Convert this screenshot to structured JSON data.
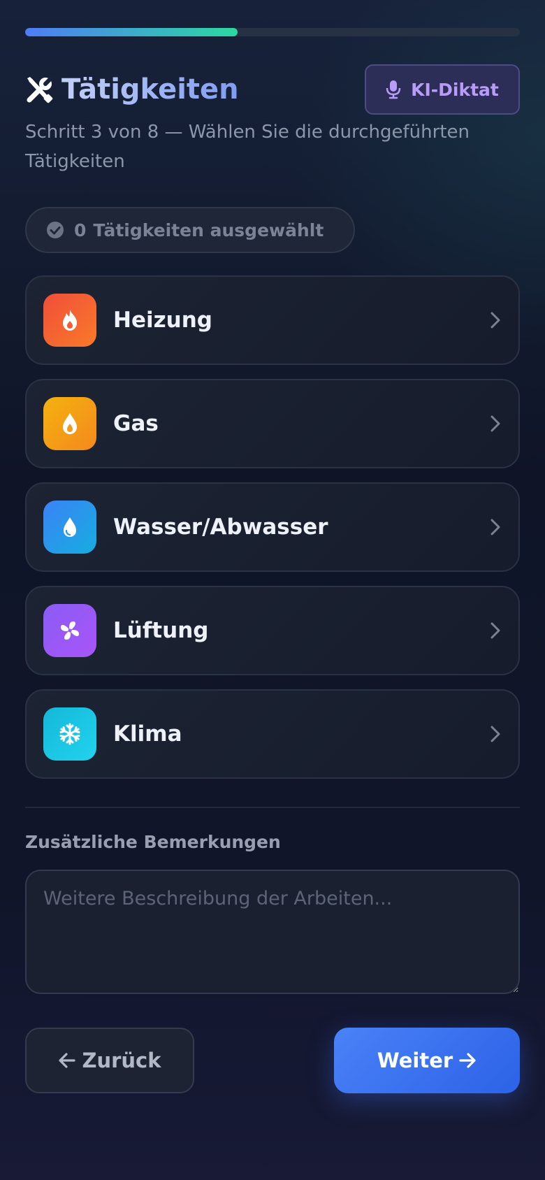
{
  "progress": {
    "current_step": 3,
    "total_steps": 8,
    "fraction": 0.43
  },
  "header": {
    "title": "Tätigkeiten",
    "title_icon": "tools-icon",
    "dictate_label": "KI-Diktat",
    "dictate_icon": "microphone-icon"
  },
  "subtitle": "Schritt 3 von 8 — Wählen Sie die durchgeführten Tätigkeiten",
  "selection": {
    "count": "0",
    "label": "Tätigkeiten ausgewählt",
    "icon": "check-circle-icon"
  },
  "categories": [
    {
      "label": "Heizung",
      "icon": "flame-icon",
      "colors": [
        "#f04e3a",
        "#f97a2a"
      ]
    },
    {
      "label": "Gas",
      "icon": "gas-drop-icon",
      "colors": [
        "#f3b20e",
        "#f5891e"
      ]
    },
    {
      "label": "Wasser/Abwasser",
      "icon": "water-drop-icon",
      "colors": [
        "#3b82f6",
        "#16aee0"
      ]
    },
    {
      "label": "Lüftung",
      "icon": "fan-icon",
      "colors": [
        "#8b5cf6",
        "#a855f7"
      ]
    },
    {
      "label": "Klima",
      "icon": "snowflake-icon",
      "colors": [
        "#14b8d8",
        "#22d3ee"
      ]
    }
  ],
  "remarks": {
    "label": "Zusätzliche Bemerkungen",
    "placeholder": "Weitere Beschreibung der Arbeiten...",
    "value": ""
  },
  "navigation": {
    "back_label": "Zurück",
    "next_label": "Weiter",
    "back_icon": "arrow-left-icon",
    "next_icon": "arrow-right-icon"
  },
  "colors": {
    "accent": "#3b6ef0",
    "progress_start": "#4f7df5",
    "progress_end": "#2bd9a1",
    "dictate_text": "#b89cf7"
  }
}
